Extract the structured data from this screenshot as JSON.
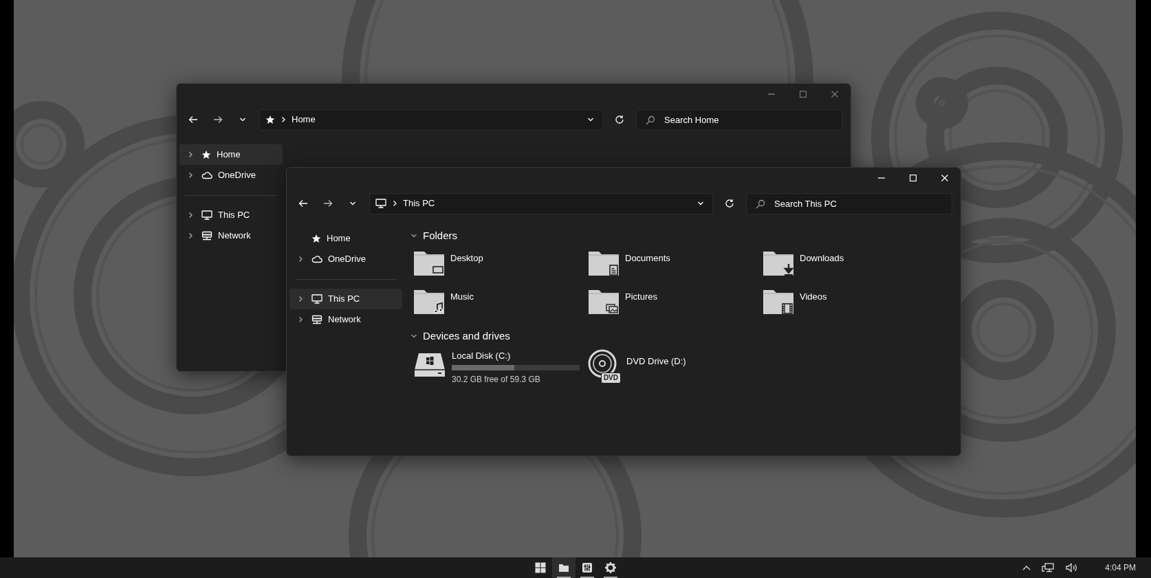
{
  "windows": [
    {
      "active": false,
      "address": {
        "kind": "star",
        "crumbs": [
          "Home"
        ]
      },
      "search": {
        "placeholder": "Search Home"
      },
      "sidebar": [
        {
          "items": [
            {
              "label": "Home",
              "kind": "star",
              "expandable": true,
              "selected": true
            },
            {
              "label": "OneDrive",
              "kind": "cloud",
              "expandable": true,
              "selected": false
            }
          ]
        },
        {
          "items": [
            {
              "label": "This PC",
              "kind": "pc",
              "expandable": true,
              "selected": false
            },
            {
              "label": "Network",
              "kind": "network",
              "expandable": true,
              "selected": false
            }
          ]
        }
      ]
    },
    {
      "active": true,
      "address": {
        "kind": "pc",
        "crumbs": [
          "This PC"
        ]
      },
      "search": {
        "placeholder": "Search This PC"
      },
      "sidebar": [
        {
          "items": [
            {
              "label": "Home",
              "kind": "star",
              "expandable": false,
              "selected": false
            },
            {
              "label": "OneDrive",
              "kind": "cloud",
              "expandable": true,
              "selected": false
            }
          ]
        },
        {
          "items": [
            {
              "label": "This PC",
              "kind": "pc",
              "expandable": true,
              "selected": true
            },
            {
              "label": "Network",
              "kind": "network",
              "expandable": true,
              "selected": false
            }
          ]
        }
      ],
      "sections": [
        {
          "title": "Folders",
          "expanded": true,
          "items": [
            {
              "kind": "desktop",
              "label": "Desktop"
            },
            {
              "kind": "documents",
              "label": "Documents"
            },
            {
              "kind": "downloads",
              "label": "Downloads"
            },
            {
              "kind": "music",
              "label": "Music"
            },
            {
              "kind": "pictures",
              "label": "Pictures"
            },
            {
              "kind": "videos",
              "label": "Videos"
            }
          ]
        },
        {
          "title": "Devices and drives",
          "expanded": true,
          "items": [
            {
              "kind": "disk",
              "label": "Local Disk (C:)",
              "level": 0.49,
              "detail": "30.2 GB free of 59.3 GB"
            },
            {
              "kind": "optical",
              "label": "DVD Drive (D:)",
              "badge": "DVD"
            }
          ]
        }
      ]
    }
  ],
  "taskbar": {
    "apps": [
      {
        "kind": "start",
        "selected": false,
        "running": false
      },
      {
        "kind": "folder",
        "selected": true,
        "running": true
      },
      {
        "kind": "mixer",
        "selected": false,
        "running": true
      },
      {
        "kind": "gear",
        "selected": false,
        "running": true
      }
    ],
    "tray": [
      {
        "kind": "chevron-up"
      },
      {
        "kind": "network"
      },
      {
        "kind": "volume"
      }
    ],
    "clock": "4:04 PM"
  }
}
